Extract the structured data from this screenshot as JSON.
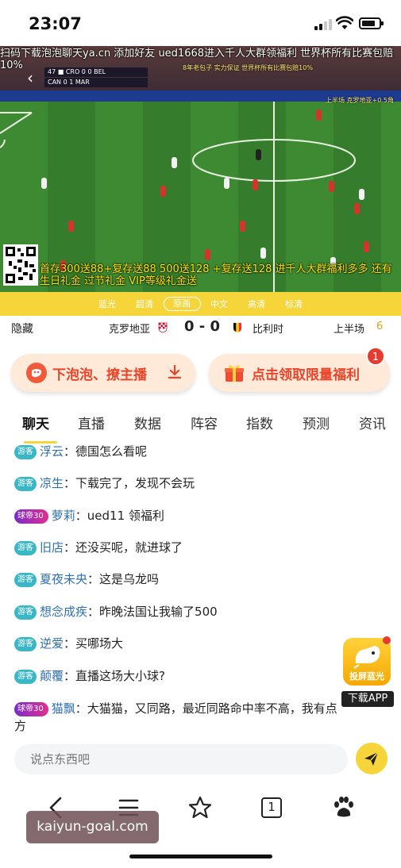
{
  "status_bar": {
    "time": "23:07"
  },
  "video": {
    "overlay_text": "扫码下载泡泡聊天ya.cn 添加好友 ued1668进入千人大群领福利 世界杯所有比赛包赔10%",
    "scorebug": {
      "line1": "47 ■ CRO 0  0 BEL",
      "line2": "CAN 0  1 MAR"
    },
    "promo_small": "8年老包子 实力保证  世界杯所有比赛包赔10%",
    "promo_right": "上半场 克罗地亚+0.5角",
    "bottom_promo": "首存300送88+复存送88 500送128 +复存送128 进千人大群福利多多 还有生日礼金 过节礼金 VIP等级礼金送"
  },
  "quality_options": [
    "蓝光",
    "超清",
    "原画",
    "中文",
    "高清",
    "标清"
  ],
  "match": {
    "hide_label": "隐藏",
    "team_home": "克罗地亚",
    "score": "0 - 0",
    "team_away": "比利时",
    "period": "上半场",
    "minute": "6"
  },
  "promo_buttons": {
    "download": "下泡泡、撩主播",
    "claim": "点击领取限量福利",
    "claim_badge": "1"
  },
  "tabs": [
    "聊天",
    "直播",
    "数据",
    "阵容",
    "指数",
    "预测",
    "资讯"
  ],
  "chat": [
    {
      "tag": "游客",
      "name": "浮云",
      "text": "德国怎么看呢"
    },
    {
      "tag": "游客",
      "name": "凉生",
      "text": "下载完了，发现不会玩"
    },
    {
      "tag": "球帝30",
      "name": "萝莉",
      "text": "ued11 领福利"
    },
    {
      "tag": "游客",
      "name": "旧店",
      "text": "还没买呢，就进球了"
    },
    {
      "tag": "游客",
      "name": "夏夜未央",
      "text": "这是乌龙吗"
    },
    {
      "tag": "游客",
      "name": "想念成疾",
      "text": "昨晚法国让我输了500"
    },
    {
      "tag": "游客",
      "name": "逆爱",
      "text": "买哪场大"
    },
    {
      "tag": "游客",
      "name": "颠覆",
      "text": "直播这场大小球?"
    },
    {
      "tag": "球帝30",
      "name": "猫飘",
      "text": "大猫猫，又同路，最近同路命中率不高，我有点方"
    }
  ],
  "floating_app": {
    "label": "投屏蓝光",
    "caption": "下载APP"
  },
  "input": {
    "placeholder": "说点东西吧"
  },
  "browser_nav": {
    "tab_count": "1"
  },
  "watermark": "kaiyun-goal.com",
  "colors": {
    "accent_yellow": "#f5d53a",
    "promo_red": "#e8452a",
    "guest_tag": "#3ab7c7"
  }
}
